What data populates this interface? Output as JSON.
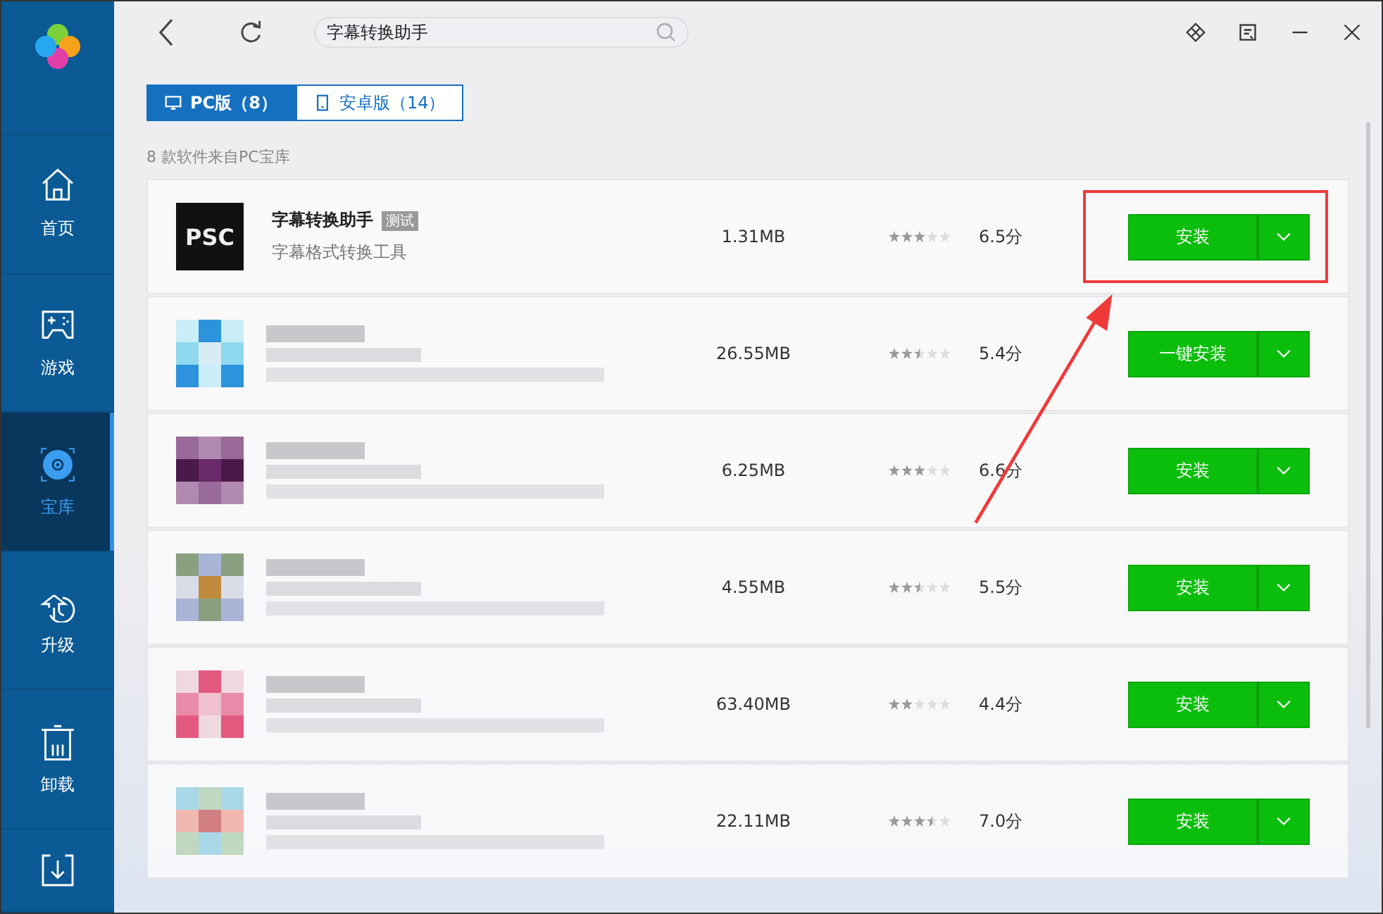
{
  "sidebar": {
    "items": [
      {
        "kind": "home",
        "label": "首页",
        "selected": false
      },
      {
        "kind": "games",
        "label": "游戏",
        "selected": false
      },
      {
        "kind": "library",
        "label": "宝库",
        "selected": true
      },
      {
        "kind": "upgrade",
        "label": "升级",
        "selected": false
      },
      {
        "kind": "uninstall",
        "label": "卸载",
        "selected": false
      },
      {
        "kind": "download",
        "selected": false
      }
    ]
  },
  "search": {
    "value": "字幕转换助手"
  },
  "tabs": [
    {
      "kind": "pc",
      "label": "PC版（8）",
      "selected": true
    },
    {
      "kind": "android",
      "label": "安卓版（14）",
      "selected": false
    }
  ],
  "caption": "8 款软件来自PC宝库",
  "apps": [
    {
      "kind": "plain",
      "logo": "PSC",
      "name": "字幕转换助手",
      "badge": "测试",
      "description": "字幕格式转换工具",
      "size": "1.31MB",
      "stars": 3,
      "score": "6.5分",
      "button": "安装"
    },
    {
      "kind": "blurred",
      "size": "26.55MB",
      "stars": 2.5,
      "score": "5.4分",
      "button": "一键安装"
    },
    {
      "kind": "blurred",
      "size": "6.25MB",
      "stars": 3,
      "score": "6.6分",
      "button": "安装"
    },
    {
      "kind": "blurred",
      "size": "4.55MB",
      "stars": 2.5,
      "score": "5.5分",
      "button": "安装"
    },
    {
      "kind": "blurred",
      "size": "63.40MB",
      "stars": 2,
      "score": "4.4分",
      "button": "安装"
    },
    {
      "kind": "blurred",
      "size": "22.11MB",
      "stars": 3.5,
      "score": "7.0分",
      "button": "安装"
    }
  ]
}
